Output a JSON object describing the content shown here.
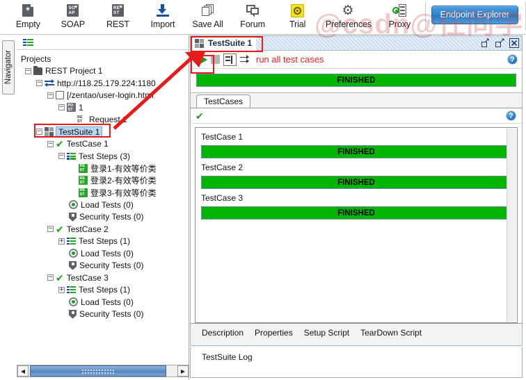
{
  "toolbar": {
    "items": [
      {
        "label": "Empty",
        "icon": "empty-project-icon"
      },
      {
        "label": "SOAP",
        "icon": "soap-project-icon"
      },
      {
        "label": "REST",
        "icon": "rest-project-icon"
      },
      {
        "label": "Import",
        "icon": "import-icon"
      },
      {
        "label": "Save All",
        "icon": "save-all-icon"
      },
      {
        "label": "Forum",
        "icon": "forum-icon"
      },
      {
        "label": "Trial",
        "icon": "trial-icon"
      },
      {
        "label": "Preferences",
        "icon": "gear-icon"
      },
      {
        "label": "Proxy",
        "icon": "proxy-icon"
      }
    ],
    "endpoint_explorer": "Endpoint Explorer"
  },
  "navigator": {
    "tab_label": "Navigator",
    "root_label": "Projects",
    "tree": {
      "project": "REST Project 1",
      "endpoint": "http://118.25.179.224:1180",
      "resource": "[/zentao/user-login.html",
      "method": "1",
      "request": "Request 1",
      "testsuite": "TestSuite 1",
      "testcase1": "TestCase 1",
      "tc1_steps": "Test Steps (3)",
      "step1": "登录1-有效等价类",
      "step2": "登录2-有效等价类",
      "step3": "登录3-有效等价类",
      "tc1_load": "Load Tests (0)",
      "tc1_sec": "Security Tests (0)",
      "testcase2": "TestCase 2",
      "tc2_steps": "Test Steps (1)",
      "tc2_load": "Load Tests (0)",
      "tc2_sec": "Security Tests (0)",
      "testcase3": "TestCase 3",
      "tc3_steps": "Test Steps (1)",
      "tc3_load": "Load Tests (0)",
      "tc3_sec": "Security Tests (0)"
    }
  },
  "testsuite_window": {
    "title": "TestSuite 1",
    "toolbar": {
      "run_label": "run all test cases",
      "help": "?"
    },
    "overall_progress": {
      "status": "FINISHED",
      "percent": 100
    },
    "tabs": [
      {
        "label": "TestCases",
        "active": true
      }
    ],
    "testcases": [
      {
        "name": "TestCase 1",
        "status": "FINISHED",
        "percent": 100
      },
      {
        "name": "TestCase 2",
        "status": "FINISHED",
        "percent": 100
      },
      {
        "name": "TestCase 3",
        "status": "FINISHED",
        "percent": 100
      }
    ],
    "bottom_tabs": [
      {
        "label": "Description"
      },
      {
        "label": "Properties"
      },
      {
        "label": "Setup Script"
      },
      {
        "label": "TearDown Script"
      }
    ]
  },
  "testsuite_log": {
    "label": "TestSuite Log"
  },
  "watermark": {
    "text": "@csdn@任同学"
  },
  "colors": {
    "progress_green": "#00b400",
    "run_label_red": "#ee1c1c",
    "annotation_red": "#e81b1b",
    "selection_blue": "#b8d6f0",
    "accent_blue": "#2d84cc"
  }
}
